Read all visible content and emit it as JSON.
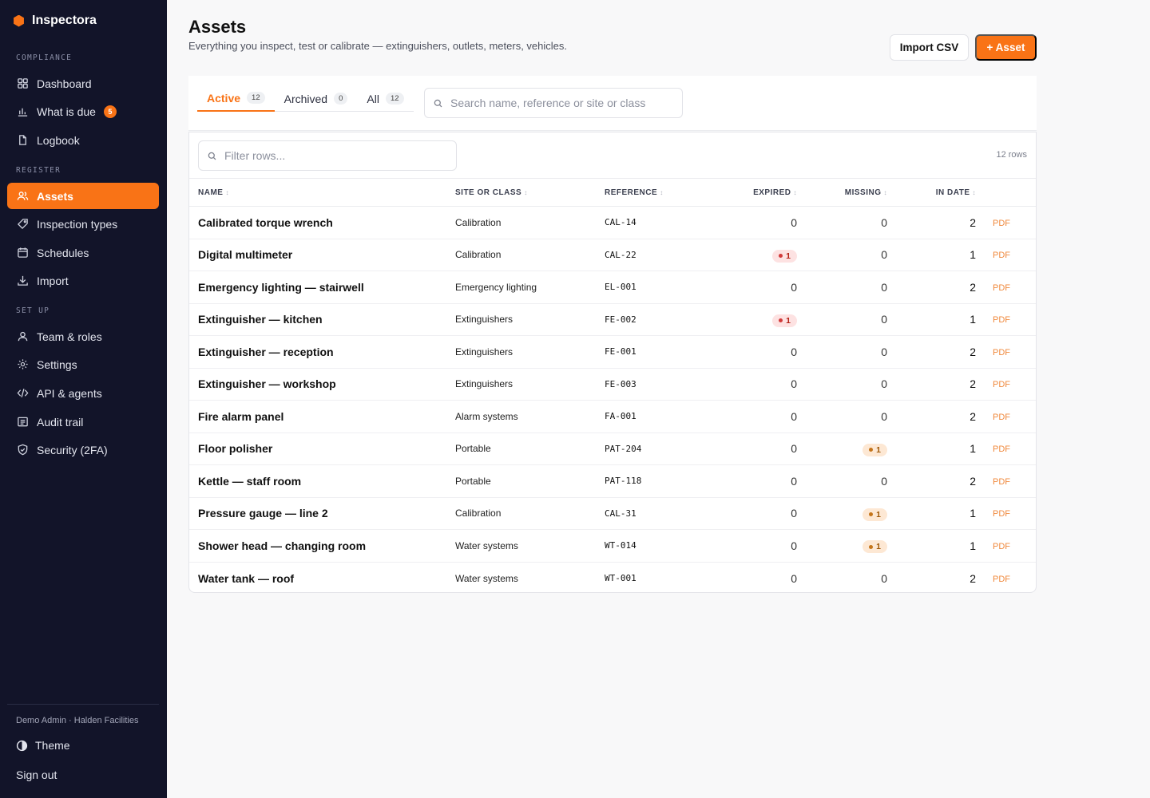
{
  "app": {
    "name": "Inspectora"
  },
  "sidebar": {
    "sections": [
      {
        "label": "COMPLIANCE",
        "items": [
          {
            "label": "Dashboard",
            "icon": "grid-icon"
          },
          {
            "label": "What is due",
            "icon": "bar-chart-icon",
            "badge": "5"
          },
          {
            "label": "Logbook",
            "icon": "document-icon"
          }
        ]
      },
      {
        "label": "REGISTER",
        "items": [
          {
            "label": "Assets",
            "icon": "users-icon",
            "active": true
          },
          {
            "label": "Inspection types",
            "icon": "tag-icon"
          },
          {
            "label": "Schedules",
            "icon": "calendar-icon"
          },
          {
            "label": "Import",
            "icon": "download-icon"
          }
        ]
      },
      {
        "label": "SET UP",
        "items": [
          {
            "label": "Team & roles",
            "icon": "user-icon"
          },
          {
            "label": "Settings",
            "icon": "gear-icon"
          },
          {
            "label": "API & agents",
            "icon": "code-icon"
          },
          {
            "label": "Audit trail",
            "icon": "list-icon"
          },
          {
            "label": "Security (2FA)",
            "icon": "shield-icon"
          }
        ]
      }
    ],
    "user": "Demo Admin · Halden Facilities",
    "theme_label": "Theme",
    "signout_label": "Sign out"
  },
  "header": {
    "title": "Assets",
    "subtitle": "Everything you inspect, test or calibrate — extinguishers, outlets, meters, vehicles.",
    "import_label": "Import CSV",
    "add_label": "+ Asset"
  },
  "tabs": [
    {
      "label": "Active",
      "count": "12",
      "active": true
    },
    {
      "label": "Archived",
      "count": "0"
    },
    {
      "label": "All",
      "count": "12"
    }
  ],
  "search": {
    "placeholder": "Search name, reference or site or class"
  },
  "filter": {
    "placeholder": "Filter rows..."
  },
  "row_count": "12 rows",
  "columns": {
    "name": "NAME",
    "site": "SITE OR CLASS",
    "ref": "REFERENCE",
    "expired": "EXPIRED",
    "missing": "MISSING",
    "indate": "IN DATE"
  },
  "pdf_label": "PDF",
  "rows": [
    {
      "name": "Calibrated torque wrench",
      "site": "Calibration",
      "ref": "CAL-14",
      "expired": "0",
      "missing": "0",
      "indate": "2"
    },
    {
      "name": "Digital multimeter",
      "site": "Calibration",
      "ref": "CAL-22",
      "expired": "1",
      "missing": "0",
      "indate": "1"
    },
    {
      "name": "Emergency lighting — stairwell",
      "site": "Emergency lighting",
      "ref": "EL-001",
      "expired": "0",
      "missing": "0",
      "indate": "2"
    },
    {
      "name": "Extinguisher — kitchen",
      "site": "Extinguishers",
      "ref": "FE-002",
      "expired": "1",
      "missing": "0",
      "indate": "1"
    },
    {
      "name": "Extinguisher — reception",
      "site": "Extinguishers",
      "ref": "FE-001",
      "expired": "0",
      "missing": "0",
      "indate": "2"
    },
    {
      "name": "Extinguisher — workshop",
      "site": "Extinguishers",
      "ref": "FE-003",
      "expired": "0",
      "missing": "0",
      "indate": "2"
    },
    {
      "name": "Fire alarm panel",
      "site": "Alarm systems",
      "ref": "FA-001",
      "expired": "0",
      "missing": "0",
      "indate": "2"
    },
    {
      "name": "Floor polisher",
      "site": "Portable",
      "ref": "PAT-204",
      "expired": "0",
      "missing": "1",
      "indate": "1"
    },
    {
      "name": "Kettle — staff room",
      "site": "Portable",
      "ref": "PAT-118",
      "expired": "0",
      "missing": "0",
      "indate": "2"
    },
    {
      "name": "Pressure gauge — line 2",
      "site": "Calibration",
      "ref": "CAL-31",
      "expired": "0",
      "missing": "1",
      "indate": "1"
    },
    {
      "name": "Shower head — changing room",
      "site": "Water systems",
      "ref": "WT-014",
      "expired": "0",
      "missing": "1",
      "indate": "1"
    },
    {
      "name": "Water tank — roof",
      "site": "Water systems",
      "ref": "WT-001",
      "expired": "0",
      "missing": "0",
      "indate": "2"
    }
  ],
  "colors": {
    "accent": "#f97316",
    "sidebar": "#121429",
    "expired_pill": "#fde2e2",
    "missing_pill": "#fde8d4"
  }
}
